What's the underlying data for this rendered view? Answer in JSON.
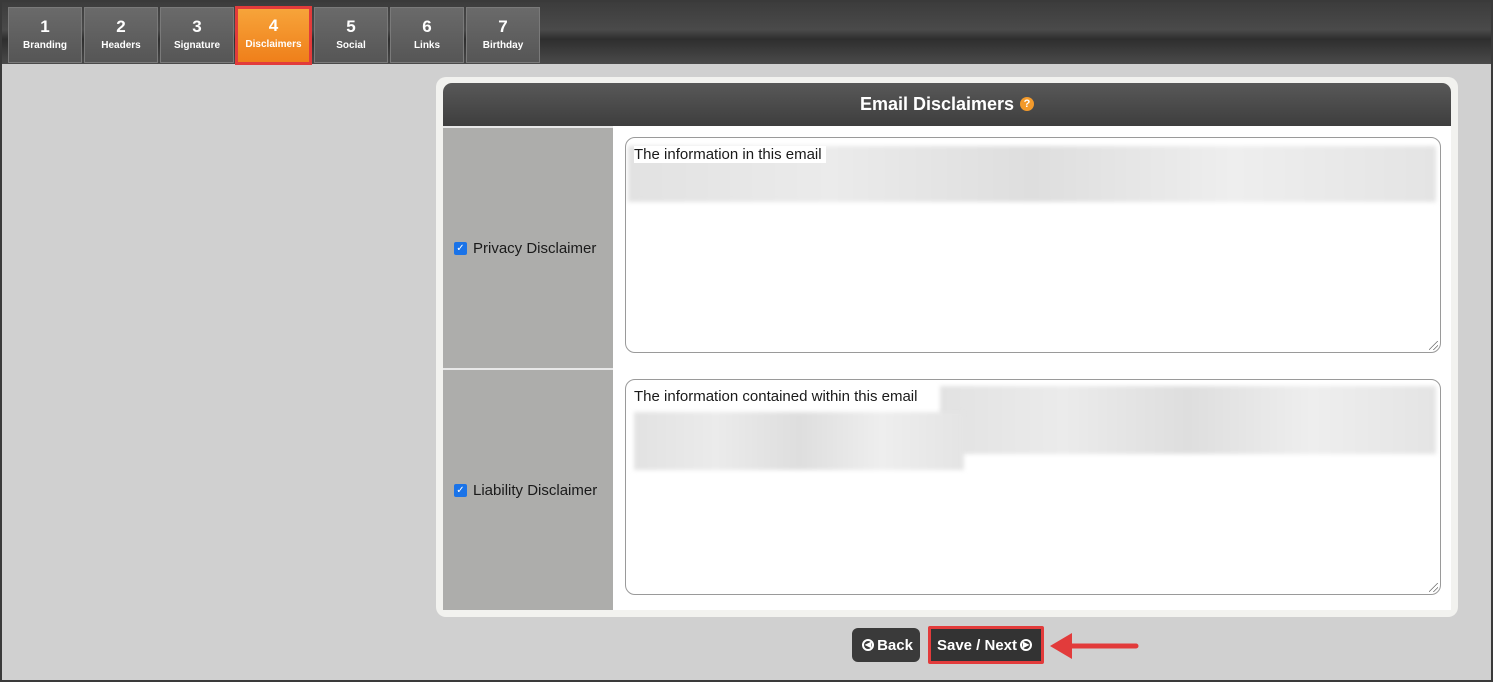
{
  "tabs": [
    {
      "num": "1",
      "label": "Branding"
    },
    {
      "num": "2",
      "label": "Headers"
    },
    {
      "num": "3",
      "label": "Signature"
    },
    {
      "num": "4",
      "label": "Disclaimers"
    },
    {
      "num": "5",
      "label": "Social"
    },
    {
      "num": "6",
      "label": "Links"
    },
    {
      "num": "7",
      "label": "Birthday"
    }
  ],
  "active_tab": "4",
  "panel": {
    "title": "Email Disclaimers",
    "help_icon": "question-circle-icon"
  },
  "disclaimers": [
    {
      "label": "Privacy Disclaimer",
      "checked": true,
      "text": "The information in this email"
    },
    {
      "label": "Liability Disclaimer",
      "checked": true,
      "text": "The information contained within this email"
    }
  ],
  "buttons": {
    "back_label": "Back",
    "next_label": "Save / Next"
  },
  "colors": {
    "accent": "#ef7f1a",
    "highlight": "#e23b3b",
    "header": "#3e3e3e"
  }
}
